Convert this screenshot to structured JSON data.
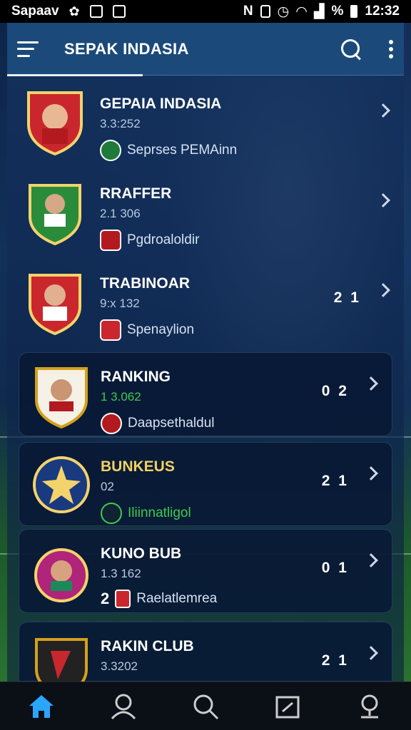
{
  "status_bar": {
    "carrier": "Sapaav",
    "battery_text": "%",
    "time": "12:32"
  },
  "app_bar": {
    "title": "SEPAK INDASIA"
  },
  "teams": [
    {
      "name": "GEPAIA INDASIA",
      "meta": "3.3:252",
      "sub": "Seprses PEMAinn",
      "score": "",
      "crest_color": "#c9272d"
    },
    {
      "name": "RRAFFER",
      "meta": "2.1 306",
      "sub": "Pgdroaloldir",
      "score": "",
      "crest_color": "#2a8c3a"
    },
    {
      "name": "TRABINOAR",
      "meta": "9:x 132",
      "sub": "Spenaylion",
      "score": "2 1",
      "crest_color": "#c9272d"
    },
    {
      "name": "RANKING",
      "meta": "1 3.062",
      "sub": "Daapsethaldul",
      "score": "0 2",
      "crest_color": "#ffffff"
    },
    {
      "name": "BUNKEUS",
      "meta": "02",
      "sub": "Iliinnatligol",
      "score": "2 1",
      "crest_color": "#1a3a80"
    },
    {
      "name": "KUNO BUB",
      "meta": "1.3 162",
      "sub": "Raelatlemrea",
      "score": "0 1",
      "crest_color": "#b0247a"
    },
    {
      "name": "RAKIN CLUB",
      "meta": "3.3202",
      "sub": "",
      "score": "2 1",
      "crest_color": "#d4a11c"
    }
  ],
  "sub_prefix_kuno": "2",
  "colors": {
    "accent": "#2aa6ff",
    "app_bar": "#1b4a7a",
    "name_yellow": "#f0d060",
    "green_text": "#3ecb4e"
  },
  "bottom_nav": [
    "home-icon",
    "profile-icon",
    "search-icon",
    "calendar-icon",
    "map-pin-icon"
  ]
}
